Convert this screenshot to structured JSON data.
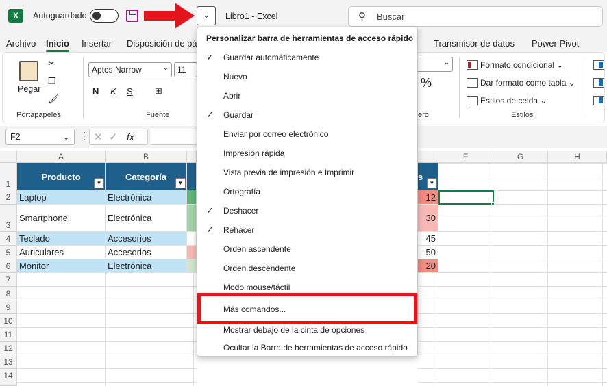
{
  "titlebar": {
    "excel_icon": "X",
    "autosave_label": "Autoguardado",
    "window_title": "Libro1  -  Excel",
    "search_placeholder": "Buscar",
    "qat_dropdown": "⌄",
    "search_icon": "search-icon"
  },
  "tabs": [
    "Archivo",
    "Inicio",
    "Insertar",
    "Disposición de pá",
    "Transmisor de datos",
    "Power Pivot"
  ],
  "ribbon": {
    "paste_label": "Pegar",
    "portapapeles": "Portapapeles",
    "font_name": "Aptos Narrow",
    "font_size": "11",
    "bold": "N",
    "italic": "K",
    "underline": "S",
    "fuente": "Fuente",
    "percent": "%",
    "numero": "ero",
    "cond_format": "Formato condicional ⌄",
    "table_format": "Dar formato como tabla ⌄",
    "cell_styles": "Estilos de celda ⌄",
    "estilos": "Estilos"
  },
  "formula_bar": {
    "name_box": "F2",
    "fx": "fx"
  },
  "columns": [
    "A",
    "B",
    "F",
    "G",
    "H"
  ],
  "rows": [
    "1",
    "2",
    "3",
    "4",
    "5",
    "6",
    "7",
    "8",
    "9",
    "10",
    "11",
    "12",
    "13",
    "14"
  ],
  "table": {
    "headers": [
      "Producto",
      "Categoría"
    ],
    "header_tail": "s",
    "rows": [
      {
        "producto": "Laptop",
        "categoria": "Electrónica",
        "valor": "12"
      },
      {
        "producto": "Smartphone",
        "categoria": "Electrónica",
        "valor": "30"
      },
      {
        "producto": "Teclado",
        "categoria": "Accesorios",
        "valor": "45"
      },
      {
        "producto": "Auriculares",
        "categoria": "Accesorios",
        "valor": "50"
      },
      {
        "producto": "Monitor",
        "categoria": "Electrónica",
        "valor": "20"
      }
    ]
  },
  "menu": {
    "title": "Personalizar barra de herramientas de acceso rápido",
    "items": [
      {
        "label": "Guardar automáticamente",
        "checked": "✓"
      },
      {
        "label": "Nuevo",
        "checked": ""
      },
      {
        "label": "Abrir",
        "checked": ""
      },
      {
        "label": "Guardar",
        "checked": "✓"
      },
      {
        "label": "Enviar por correo electrónico",
        "checked": ""
      },
      {
        "label": "Impresión rápida",
        "checked": ""
      },
      {
        "label": "Vista previa de impresión e Imprimir",
        "checked": ""
      },
      {
        "label": "Ortografía",
        "checked": ""
      },
      {
        "label": "Deshacer",
        "checked": "✓"
      },
      {
        "label": "Rehacer",
        "checked": "✓"
      },
      {
        "label": "Orden ascendente",
        "checked": ""
      },
      {
        "label": "Orden descendente",
        "checked": ""
      },
      {
        "label": "Modo mouse/táctil",
        "checked": ""
      },
      {
        "label": "Más comandos...",
        "checked": ""
      },
      {
        "label": "Mostrar debajo de la cinta de opciones",
        "checked": ""
      },
      {
        "label": "Ocultar la Barra de herramientas de acceso rápido",
        "checked": ""
      }
    ]
  },
  "colors": {
    "excel_green": "#107c41",
    "table_header": "#1f5f8b",
    "row_band": "#bfe3f5",
    "highlight_red": "#e3141c",
    "arrow_red": "#e3141c"
  }
}
